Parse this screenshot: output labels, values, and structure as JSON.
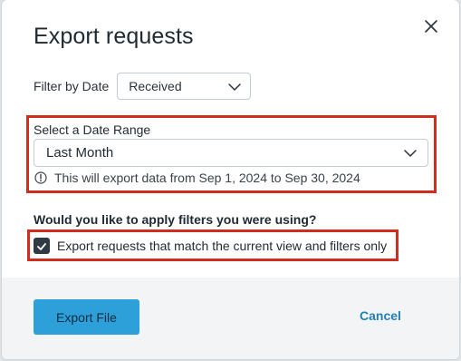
{
  "modal": {
    "title": "Export requests",
    "close_icon": "close-icon"
  },
  "filter_by_date": {
    "label": "Filter by Date",
    "selected": "Received"
  },
  "date_range": {
    "label": "Select a Date Range",
    "selected": "Last Month",
    "info_text": "This will export data from Sep 1, 2024 to Sep 30, 2024"
  },
  "filters_question": {
    "text": "Would you like to apply filters you were using?",
    "checkbox_label": "Export requests that match the current view and filters only",
    "checked": true
  },
  "footer": {
    "export_label": "Export File",
    "cancel_label": "Cancel"
  },
  "colors": {
    "accent": "#2d9fd9",
    "highlight": "#d12d1f",
    "link": "#2380b5"
  }
}
